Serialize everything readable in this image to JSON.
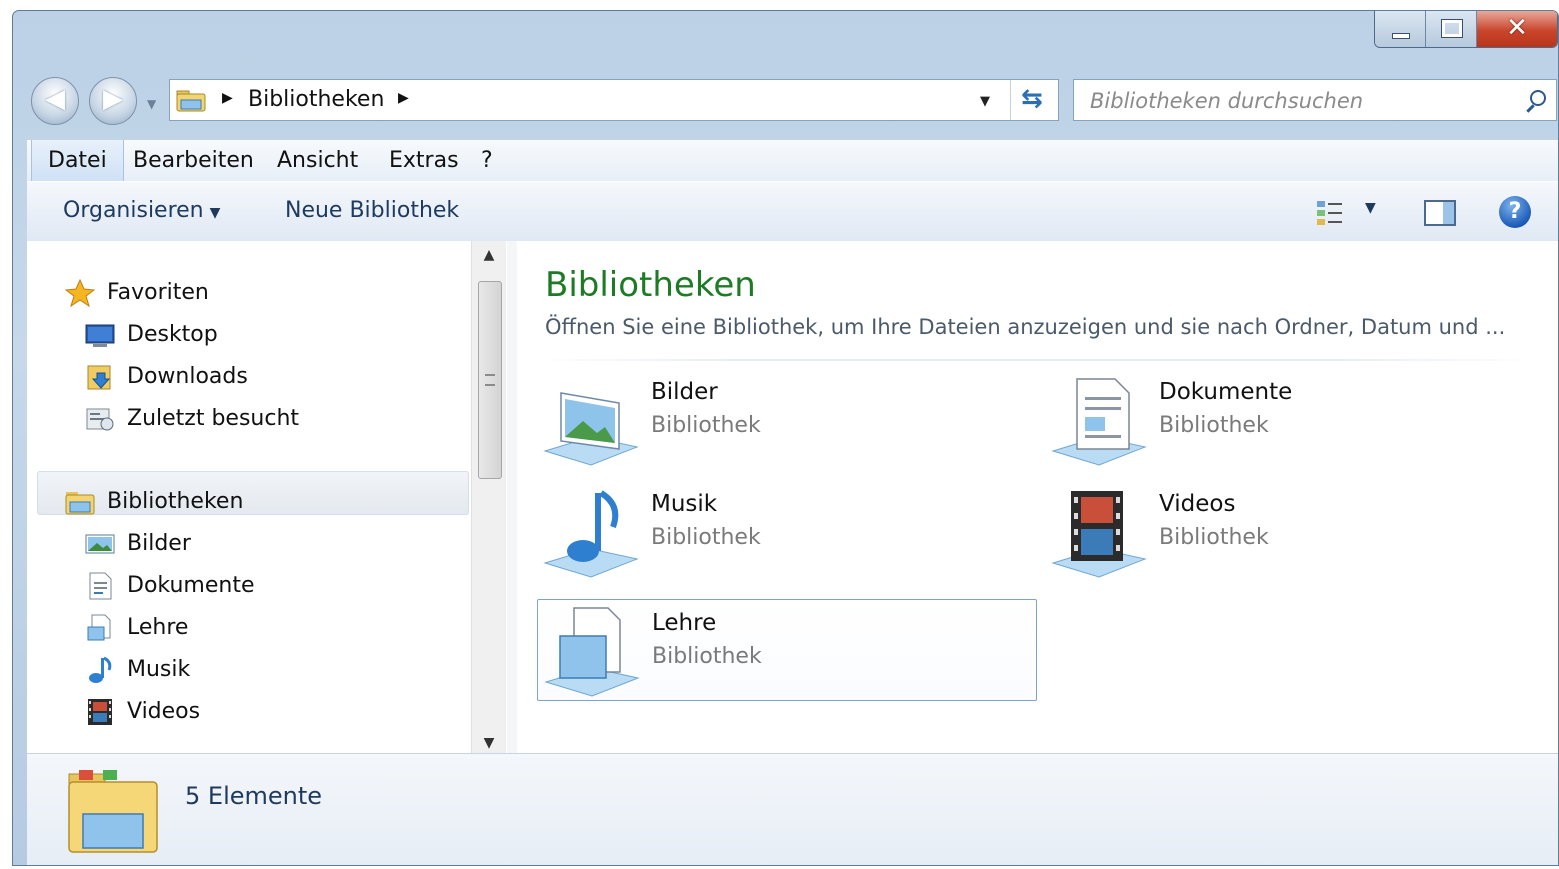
{
  "window": {
    "title": "Bibliotheken"
  },
  "navigation": {
    "back_glyph": "◀",
    "forward_glyph": "▶",
    "address": {
      "path": [
        "Bibliotheken"
      ],
      "separator": "▶"
    },
    "search": {
      "placeholder": "Bibliotheken durchsuchen"
    }
  },
  "menu": {
    "items": [
      "Datei",
      "Bearbeiten",
      "Ansicht",
      "Extras",
      "?"
    ],
    "active_index": 0
  },
  "toolbar": {
    "organize_label": "Organisieren",
    "new_library_label": "Neue Bibliothek",
    "help_glyph": "?"
  },
  "sidebar": {
    "favorites": {
      "label": "Favoriten",
      "items": [
        {
          "label": "Desktop",
          "icon": "desktop-icon"
        },
        {
          "label": "Downloads",
          "icon": "downloads-folder-icon"
        },
        {
          "label": "Zuletzt besucht",
          "icon": "recent-places-icon"
        }
      ]
    },
    "libraries": {
      "label": "Bibliotheken",
      "items": [
        {
          "label": "Bilder",
          "icon": "pictures-icon"
        },
        {
          "label": "Dokumente",
          "icon": "documents-icon"
        },
        {
          "label": "Lehre",
          "icon": "library-icon"
        },
        {
          "label": "Musik",
          "icon": "music-icon"
        },
        {
          "label": "Videos",
          "icon": "videos-icon"
        }
      ]
    }
  },
  "content": {
    "title": "Bibliotheken",
    "subtitle": "Öffnen Sie eine Bibliothek, um Ihre Dateien anzuzeigen und sie nach Ordner, Datum und ...",
    "libraries": [
      {
        "name": "Bilder",
        "type": "Bibliothek",
        "icon": "pictures-library-icon"
      },
      {
        "name": "Dokumente",
        "type": "Bibliothek",
        "icon": "documents-library-icon"
      },
      {
        "name": "Musik",
        "type": "Bibliothek",
        "icon": "music-library-icon"
      },
      {
        "name": "Videos",
        "type": "Bibliothek",
        "icon": "videos-library-icon"
      },
      {
        "name": "Lehre",
        "type": "Bibliothek",
        "icon": "generic-library-icon",
        "selected": true
      }
    ]
  },
  "details": {
    "count": "5 Elemente",
    "icon": "libraries-folder-icon"
  },
  "colors": {
    "title_green": "#1e7b25",
    "accent_blue": "#1d5db8",
    "close_red": "#c9462c"
  }
}
